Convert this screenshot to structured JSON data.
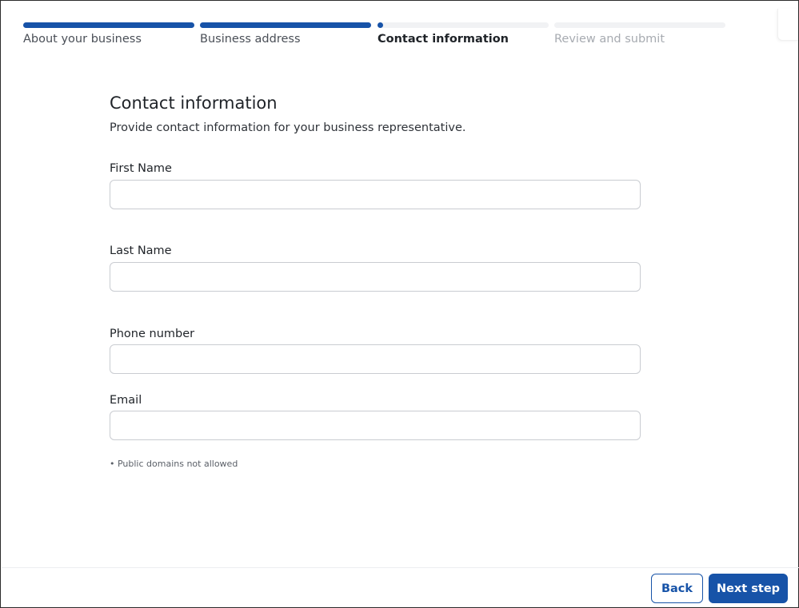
{
  "stepper": {
    "steps": [
      {
        "label": "About your business",
        "state": "complete",
        "progress": 1.0
      },
      {
        "label": "Business address",
        "state": "complete",
        "progress": 1.0
      },
      {
        "label": "Contact information",
        "state": "current",
        "progress": 0.0
      },
      {
        "label": "Review and submit",
        "state": "upcoming",
        "progress": 0.0
      }
    ],
    "accent_color": "#1753a8",
    "track_color": "#f1f2f4"
  },
  "form": {
    "title": "Contact information",
    "subtitle": "Provide contact information for your business representative.",
    "fields": {
      "first_name": {
        "label": "First Name",
        "value": ""
      },
      "last_name": {
        "label": "Last Name",
        "value": ""
      },
      "phone": {
        "label": "Phone number",
        "value": ""
      },
      "email": {
        "label": "Email",
        "value": ""
      }
    },
    "email_hint": "• Public domains not allowed"
  },
  "footer": {
    "back_label": "Back",
    "next_label": "Next step"
  }
}
